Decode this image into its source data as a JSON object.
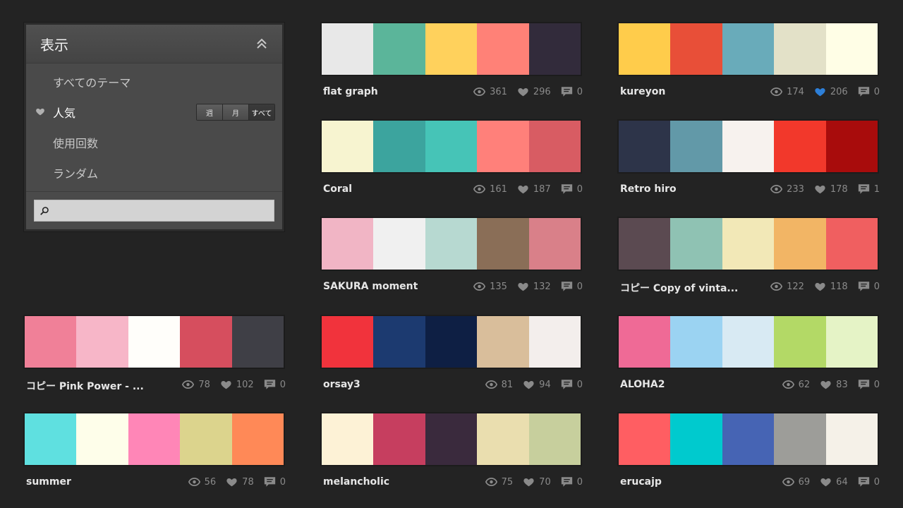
{
  "filter_panel": {
    "title": "表示",
    "menu": [
      {
        "label": "すべてのテーマ"
      },
      {
        "label": "人気"
      },
      {
        "label": "使用回数"
      },
      {
        "label": "ランダム"
      }
    ],
    "period": {
      "week": "週",
      "month": "月",
      "all": "すべて",
      "selected": "すべて"
    },
    "search": {
      "value": "",
      "placeholder": ""
    }
  },
  "icons": {
    "view": "eye-icon",
    "like": "heart-icon",
    "comment": "comment-icon",
    "collapse": "chevron-up-double-icon",
    "search": "search-icon"
  },
  "colors": {
    "liked": "#2d7fd8",
    "stat": "#8a8a8a"
  },
  "palettes": [
    {
      "name": "flat graph",
      "colors": [
        "#E8E8E8",
        "#5BB59A",
        "#FFD15C",
        "#FF8177",
        "#322B3B"
      ],
      "views": "361",
      "likes": "296",
      "comments": "0",
      "liked": false
    },
    {
      "name": "kureyon",
      "colors": [
        "#FFCC4B",
        "#E84F38",
        "#69ABBA",
        "#E3E1C8",
        "#FFFEE6"
      ],
      "views": "174",
      "likes": "206",
      "comments": "0",
      "liked": true
    },
    {
      "name": "Coral",
      "colors": [
        "#F7F4D0",
        "#3CA49E",
        "#46C4B7",
        "#FF807A",
        "#D85C63"
      ],
      "views": "161",
      "likes": "187",
      "comments": "0",
      "liked": false
    },
    {
      "name": "Retro hiro",
      "colors": [
        "#2D3449",
        "#6299A8",
        "#F7F2EE",
        "#F2382B",
        "#A80C0C"
      ],
      "views": "233",
      "likes": "178",
      "comments": "1",
      "liked": false
    },
    {
      "name": "SAKURA moment",
      "colors": [
        "#F1B5C5",
        "#F0F0F0",
        "#B7D9D1",
        "#8A6E57",
        "#D98089"
      ],
      "views": "135",
      "likes": "132",
      "comments": "0",
      "liked": false
    },
    {
      "name": "コピー Copy of vinta...",
      "colors": [
        "#5B4A51",
        "#8FC2B3",
        "#F2E8B7",
        "#F2B565",
        "#F05F60"
      ],
      "views": "122",
      "likes": "118",
      "comments": "0",
      "liked": false
    },
    {
      "name": "コピー Pink Power - ...",
      "colors": [
        "#F08098",
        "#F7B6C8",
        "#FFFEFA",
        "#D64E5E",
        "#3F3F46"
      ],
      "views": "78",
      "likes": "102",
      "comments": "0",
      "liked": false
    },
    {
      "name": "orsay3",
      "colors": [
        "#F1333C",
        "#1C3A70",
        "#0E1F44",
        "#D9BE9B",
        "#F3EEEC"
      ],
      "views": "81",
      "likes": "94",
      "comments": "0",
      "liked": false
    },
    {
      "name": "ALOHA2",
      "colors": [
        "#EF6A96",
        "#9BD3F2",
        "#D8EAF3",
        "#B3D966",
        "#E5F3C6"
      ],
      "views": "62",
      "likes": "83",
      "comments": "0",
      "liked": false
    },
    {
      "name": "summer",
      "colors": [
        "#5FE0E0",
        "#FEFEEA",
        "#FF86B7",
        "#DCD48D",
        "#FF8957"
      ],
      "views": "56",
      "likes": "78",
      "comments": "0",
      "liked": false
    },
    {
      "name": "melancholic",
      "colors": [
        "#FDF2D6",
        "#C63E5F",
        "#3A2A3D",
        "#EADEAF",
        "#C7CF9D"
      ],
      "views": "75",
      "likes": "70",
      "comments": "0",
      "liked": false
    },
    {
      "name": "erucajp",
      "colors": [
        "#FF5E62",
        "#00CACE",
        "#4664B4",
        "#9D9D99",
        "#F5F1E8"
      ],
      "views": "69",
      "likes": "64",
      "comments": "0",
      "liked": false
    }
  ]
}
